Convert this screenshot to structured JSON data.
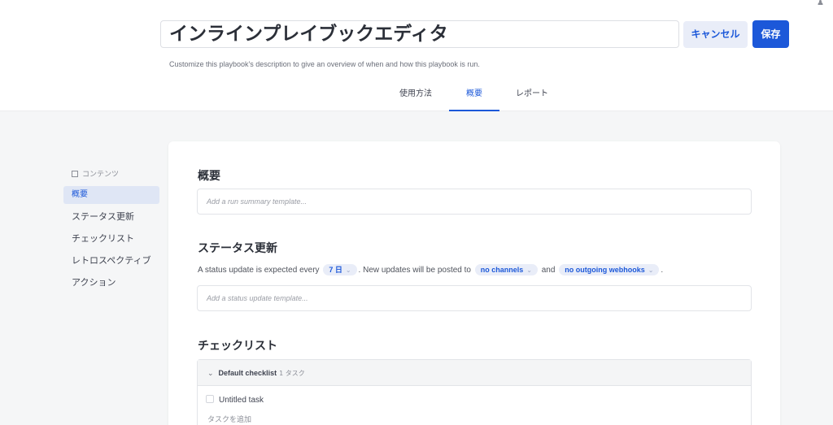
{
  "header": {
    "title": "インラインプレイブックエディタ",
    "cancel_label": "キャンセル",
    "save_label": "保存",
    "description": "Customize this playbook's description to give an overview of when and how this playbook is run."
  },
  "tabs": [
    {
      "label": "使用方法",
      "active": false
    },
    {
      "label": "概要",
      "active": true
    },
    {
      "label": "レポート",
      "active": false
    }
  ],
  "toc": {
    "heading": "コンテンツ",
    "items": [
      {
        "label": "概要",
        "active": true
      },
      {
        "label": "ステータス更新",
        "active": false
      },
      {
        "label": "チェックリスト",
        "active": false
      },
      {
        "label": "レトロスペクティブ",
        "active": false
      },
      {
        "label": "アクション",
        "active": false
      }
    ]
  },
  "summary": {
    "title": "概要",
    "placeholder": "Add a run summary template..."
  },
  "status_update": {
    "title": "ステータス更新",
    "text_1": "A status update is expected every",
    "interval": "7 日",
    "text_2": ". New updates will be posted to",
    "channels": "no channels",
    "text_3": "and",
    "webhooks": "no outgoing webhooks",
    "text_4": ".",
    "placeholder": "Add a status update template..."
  },
  "checklists": {
    "title": "チェックリスト",
    "name": "Default checklist",
    "count": "1 タスク",
    "task": "Untitled task",
    "add_task": "タスクを追加"
  },
  "colors": {
    "accent": "#1c58d9",
    "accent_light": "#e9edf8"
  }
}
